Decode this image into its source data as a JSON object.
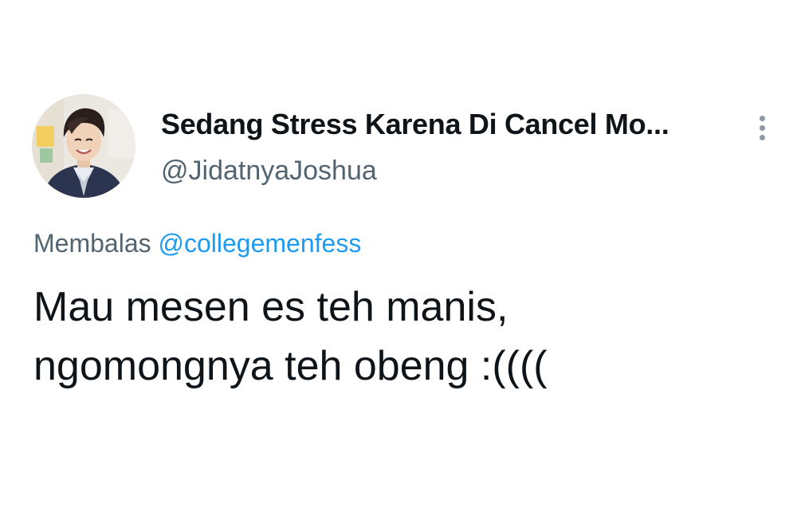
{
  "tweet": {
    "author": {
      "display_name": "Sedang Stress Karena Di Cancel Mo...",
      "handle": "@JidatnyaJoshua",
      "avatar_icon": "profile-photo"
    },
    "more_icon": "vertical-ellipsis-icon",
    "reply": {
      "prefix": "Membalas",
      "mention": "@collegemenfess"
    },
    "text_lines": [
      "Mau mesen es teh manis,",
      "ngomongnya teh obeng :(((("
    ]
  },
  "colors": {
    "text_primary": "#0f1419",
    "text_secondary": "#536471",
    "mention": "#1d9bf0",
    "icon": "#8b98a5"
  }
}
